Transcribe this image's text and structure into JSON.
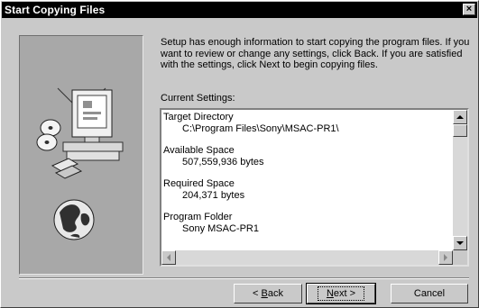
{
  "window": {
    "title": "Start Copying Files",
    "close_glyph": "×"
  },
  "intro_text": "Setup has enough information to start copying the program files.  If you want to review or change any settings, click Back.  If you are satisfied with the settings, click Next to begin copying files.",
  "current_settings_label": "Current Settings:",
  "settings": [
    {
      "label": "Target Directory",
      "value": "C:\\Program Files\\Sony\\MSAC-PR1\\"
    },
    {
      "label": "Available Space",
      "value": "507,559,936 bytes"
    },
    {
      "label": "Required Space",
      "value": "204,371 bytes"
    },
    {
      "label": "Program Folder",
      "value": "Sony MSAC-PR1"
    }
  ],
  "buttons": {
    "back": {
      "prefix": "< ",
      "mnemonic": "B",
      "rest": "ack"
    },
    "next": {
      "mnemonic": "N",
      "rest": "ext >"
    },
    "cancel": "Cancel"
  },
  "icons": [
    "computer-icon",
    "cd-discs-icon",
    "floppy-disks-icon",
    "globe-icon",
    "close-icon"
  ]
}
